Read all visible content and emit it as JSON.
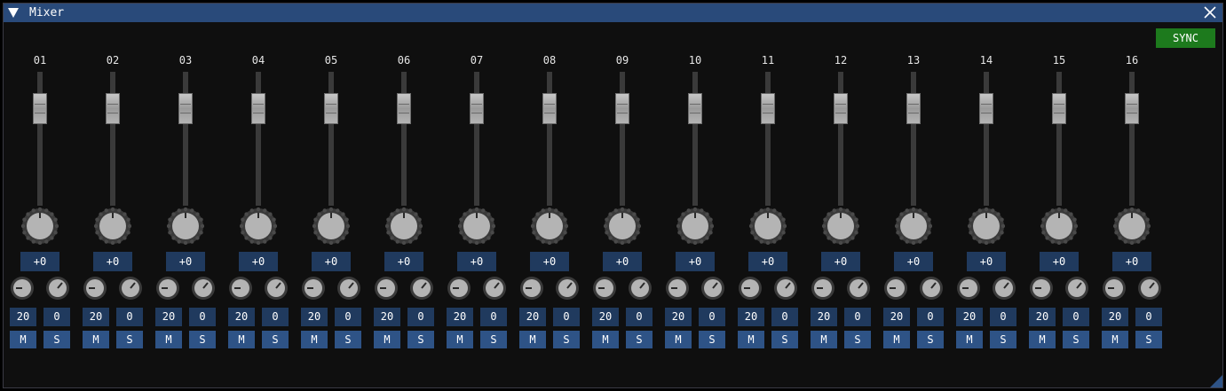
{
  "window": {
    "title": "Mixer",
    "title_bar_color": "#294a7a",
    "collapse_icon": "triangle-down-icon",
    "close_icon": "close-icon"
  },
  "toolbar": {
    "sync_label": "SYNC",
    "sync_color": "#1d7a1d"
  },
  "colors": {
    "value_box": "#203a5e",
    "button": "#2e5386",
    "knob_face": "#b4b4b4",
    "knob_ring": "#4a4a4a",
    "fader_track": "#3a3a3a"
  },
  "channels": [
    {
      "label": "01",
      "gain": "+0",
      "left_value": "20",
      "right_value": "0",
      "mute_label": "M",
      "solo_label": "S"
    },
    {
      "label": "02",
      "gain": "+0",
      "left_value": "20",
      "right_value": "0",
      "mute_label": "M",
      "solo_label": "S"
    },
    {
      "label": "03",
      "gain": "+0",
      "left_value": "20",
      "right_value": "0",
      "mute_label": "M",
      "solo_label": "S"
    },
    {
      "label": "04",
      "gain": "+0",
      "left_value": "20",
      "right_value": "0",
      "mute_label": "M",
      "solo_label": "S"
    },
    {
      "label": "05",
      "gain": "+0",
      "left_value": "20",
      "right_value": "0",
      "mute_label": "M",
      "solo_label": "S"
    },
    {
      "label": "06",
      "gain": "+0",
      "left_value": "20",
      "right_value": "0",
      "mute_label": "M",
      "solo_label": "S"
    },
    {
      "label": "07",
      "gain": "+0",
      "left_value": "20",
      "right_value": "0",
      "mute_label": "M",
      "solo_label": "S"
    },
    {
      "label": "08",
      "gain": "+0",
      "left_value": "20",
      "right_value": "0",
      "mute_label": "M",
      "solo_label": "S"
    },
    {
      "label": "09",
      "gain": "+0",
      "left_value": "20",
      "right_value": "0",
      "mute_label": "M",
      "solo_label": "S"
    },
    {
      "label": "10",
      "gain": "+0",
      "left_value": "20",
      "right_value": "0",
      "mute_label": "M",
      "solo_label": "S"
    },
    {
      "label": "11",
      "gain": "+0",
      "left_value": "20",
      "right_value": "0",
      "mute_label": "M",
      "solo_label": "S"
    },
    {
      "label": "12",
      "gain": "+0",
      "left_value": "20",
      "right_value": "0",
      "mute_label": "M",
      "solo_label": "S"
    },
    {
      "label": "13",
      "gain": "+0",
      "left_value": "20",
      "right_value": "0",
      "mute_label": "M",
      "solo_label": "S"
    },
    {
      "label": "14",
      "gain": "+0",
      "left_value": "20",
      "right_value": "0",
      "mute_label": "M",
      "solo_label": "S"
    },
    {
      "label": "15",
      "gain": "+0",
      "left_value": "20",
      "right_value": "0",
      "mute_label": "M",
      "solo_label": "S"
    },
    {
      "label": "16",
      "gain": "+0",
      "left_value": "20",
      "right_value": "0",
      "mute_label": "M",
      "solo_label": "S"
    }
  ]
}
